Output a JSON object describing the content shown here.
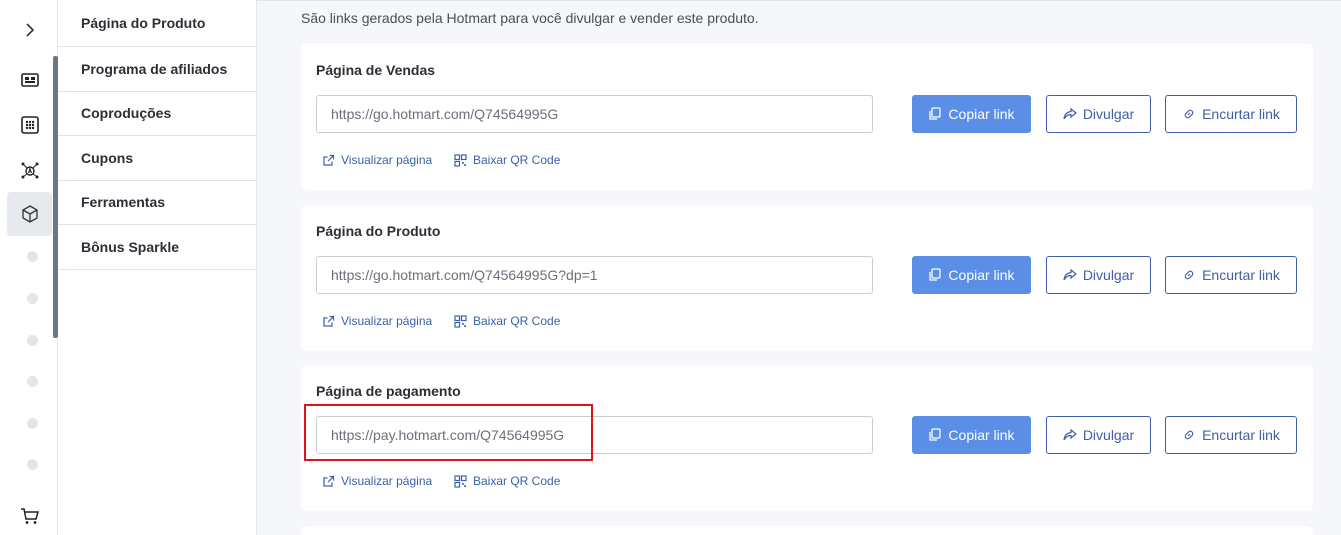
{
  "rail": {
    "expand_label": ">"
  },
  "submenu": {
    "items": [
      {
        "label": "Página do Produto"
      },
      {
        "label": "Programa de afiliados"
      },
      {
        "label": "Coproduções"
      },
      {
        "label": "Cupons"
      },
      {
        "label": "Ferramentas"
      },
      {
        "label": "Bônus Sparkle"
      }
    ]
  },
  "main": {
    "intro": "São links gerados pela Hotmart para você divulgar e vender este produto.",
    "cards": [
      {
        "title": "Página de Vendas",
        "url": "https://go.hotmart.com/Q74564995G",
        "copy_label": "Copiar link",
        "share_label": "Divulgar",
        "shorten_label": "Encurtar link",
        "view_label": "Visualizar página",
        "qr_label": "Baixar QR Code"
      },
      {
        "title": "Página do Produto",
        "url": "https://go.hotmart.com/Q74564995G?dp=1",
        "copy_label": "Copiar link",
        "share_label": "Divulgar",
        "shorten_label": "Encurtar link",
        "view_label": "Visualizar página",
        "qr_label": "Baixar QR Code"
      },
      {
        "title": "Página de pagamento",
        "url": "https://pay.hotmart.com/Q74564995G",
        "copy_label": "Copiar link",
        "share_label": "Divulgar",
        "shorten_label": "Encurtar link",
        "view_label": "Visualizar página",
        "qr_label": "Baixar QR Code"
      }
    ]
  },
  "colors": {
    "primary": "#5b8ee6",
    "accent": "#3d5fa8",
    "highlight": "#e2121b"
  }
}
